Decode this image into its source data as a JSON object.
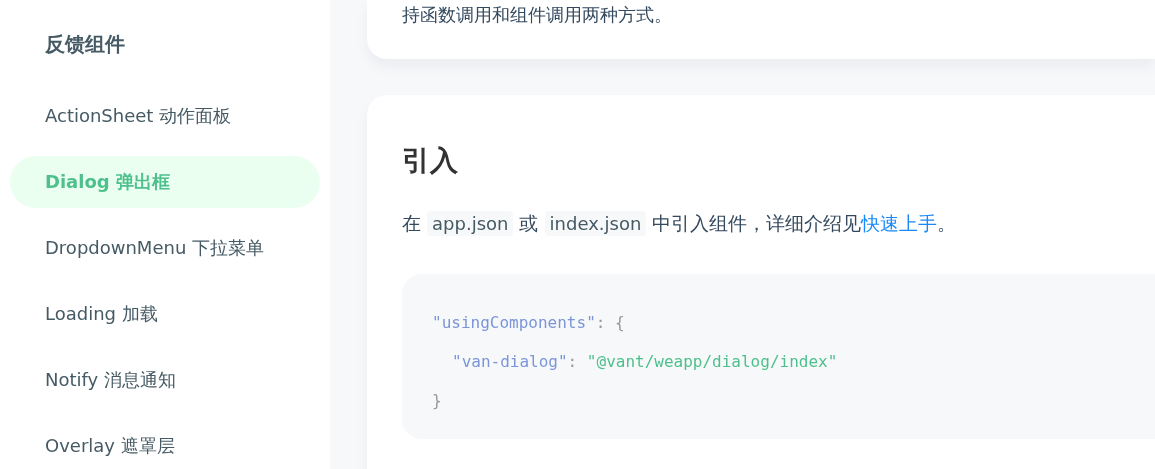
{
  "sidebar": {
    "group_title": "反馈组件",
    "items": [
      {
        "label": "ActionSheet 动作面板",
        "selected": false
      },
      {
        "label": "Dialog 弹出框",
        "selected": true
      },
      {
        "label": "DropdownMenu 下拉菜单",
        "selected": false
      },
      {
        "label": "Loading 加载",
        "selected": false
      },
      {
        "label": "Notify 消息通知",
        "selected": false
      },
      {
        "label": "Overlay 遮罩层",
        "selected": false
      }
    ]
  },
  "intro_card": {
    "text": "持函数调用和组件调用两种方式。"
  },
  "section": {
    "heading": "引入",
    "paragraph": [
      {
        "kind": "text",
        "text": "在 "
      },
      {
        "kind": "code",
        "text": "app.json"
      },
      {
        "kind": "text",
        "text": " 或 "
      },
      {
        "kind": "code",
        "text": "index.json"
      },
      {
        "kind": "text",
        "text": " 中引入组件，详细介绍见"
      },
      {
        "kind": "link",
        "text": "快速上手"
      },
      {
        "kind": "text",
        "text": "。"
      }
    ],
    "code_lines": [
      {
        "nested": false,
        "tokens": [
          {
            "kind": "key",
            "text": "\"usingComponents\""
          },
          {
            "kind": "punct",
            "text": ": {"
          }
        ]
      },
      {
        "nested": true,
        "tokens": [
          {
            "kind": "key",
            "text": "\"van-dialog\""
          },
          {
            "kind": "punct",
            "text": ": "
          },
          {
            "kind": "string",
            "text": "\"@vant/weapp/dialog/index\""
          }
        ]
      },
      {
        "nested": false,
        "tokens": [
          {
            "kind": "punct",
            "text": "}"
          }
        ]
      }
    ]
  }
}
